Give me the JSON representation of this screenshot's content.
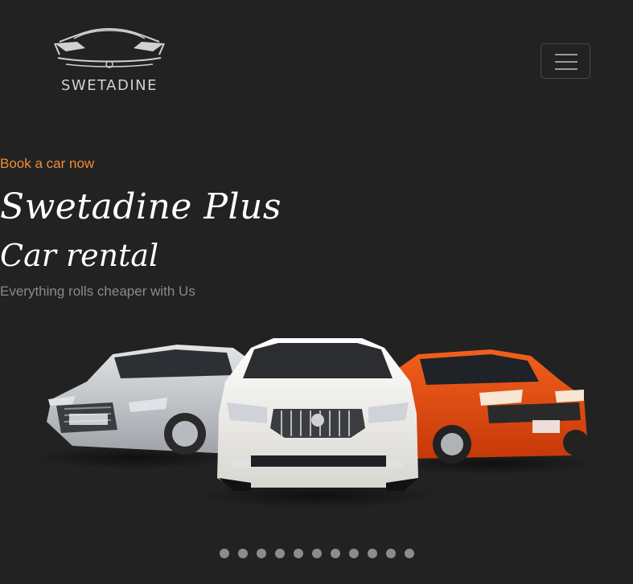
{
  "brand": {
    "name": "SWETADINE"
  },
  "header": {
    "menu_icon": "hamburger-icon"
  },
  "hero": {
    "eyebrow": "Book a car now",
    "title": "Swetadine Plus",
    "subtitle": "Car rental",
    "tagline": "Everything rolls cheaper with Us",
    "image": {
      "description_icon": "cars-illustration",
      "car_colors": [
        "#c7c9cc",
        "#f1f0ec",
        "#e0460f"
      ]
    }
  },
  "carousel": {
    "slide_count": 11,
    "active_index": 0
  },
  "colors": {
    "background": "#222222",
    "accent": "#f28c38"
  }
}
